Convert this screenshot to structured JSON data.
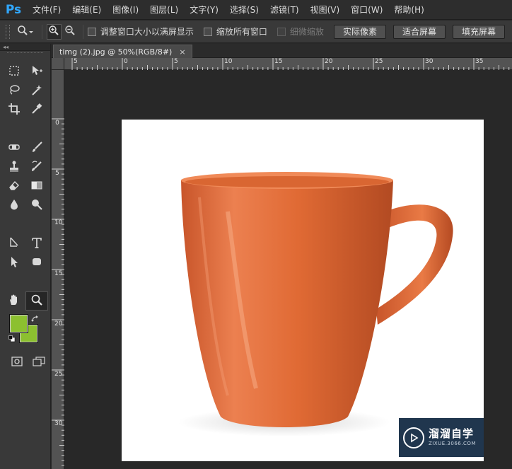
{
  "app": {
    "logo": "Ps"
  },
  "menu": [
    "文件(F)",
    "编辑(E)",
    "图像(I)",
    "图层(L)",
    "文字(Y)",
    "选择(S)",
    "滤镜(T)",
    "视图(V)",
    "窗口(W)",
    "帮助(H)"
  ],
  "options": {
    "resize_windows_label": "调整窗口大小以满屏显示",
    "zoom_all_windows_label": "缩放所有窗口",
    "scrubby_zoom_label": "细微缩放",
    "actual_pixels_label": "实际像素",
    "fit_screen_label": "适合屏幕",
    "fill_screen_label": "填充屏幕"
  },
  "document": {
    "tab_title": "timg (2).jpg @ 50%(RGB/8#)",
    "close_glyph": "×"
  },
  "toolbar": {
    "collapse_glyph": "◂◂"
  },
  "rulers": {
    "h_labels": [
      "5",
      "0",
      "5",
      "10",
      "15",
      "20",
      "25",
      "30",
      "35"
    ],
    "v_labels": [
      "0",
      "5",
      "10",
      "15",
      "20",
      "25",
      "30"
    ]
  },
  "colors": {
    "foreground": "#8cc030",
    "background": "#8cc030",
    "mug": "#e0703a"
  },
  "watermark": {
    "title": "溜溜自学",
    "url": "ZIXUE.3066.COM"
  }
}
